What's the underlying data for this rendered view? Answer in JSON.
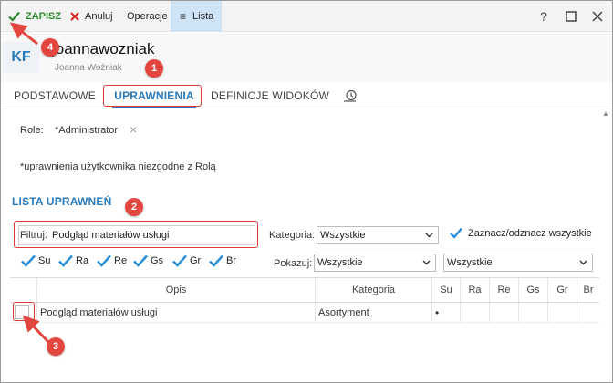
{
  "toolbar": {
    "save_label": "ZAPISZ",
    "cancel_label": "Anuluj",
    "operations_label": "Operacje",
    "list_label": "Lista",
    "help_symbol": "?"
  },
  "user": {
    "avatar_initials": "KF",
    "login": "joannawozniak",
    "full_name": "Joanna Woźniak"
  },
  "tabs": [
    {
      "label": "PODSTAWOWE"
    },
    {
      "label": "UPRAWNIENIA"
    },
    {
      "label": "DEFINICJE WIDOKÓW"
    }
  ],
  "role": {
    "label": "Role:",
    "value": "*Administrator"
  },
  "note": "*uprawnienia użytkownika niezgodne z Rolą",
  "section_title": "LISTA UPRAWNEŃ",
  "filter": {
    "label": "Filtruj:",
    "value": "Podgląd materiałów usługi"
  },
  "category": {
    "label": "Kategoria:",
    "selected": "Wszystkie"
  },
  "check_all_label": "Zaznacz/odznacz wszystkie",
  "show": {
    "label": "Pokazuj:",
    "selected_1": "Wszystkie",
    "selected_2": "Wszystkie"
  },
  "checkboxes": [
    {
      "label": "Su",
      "checked": true
    },
    {
      "label": "Ra",
      "checked": true
    },
    {
      "label": "Re",
      "checked": true
    },
    {
      "label": "Gs",
      "checked": true
    },
    {
      "label": "Gr",
      "checked": true
    },
    {
      "label": "Br",
      "checked": true
    }
  ],
  "table": {
    "columns": [
      "Opis",
      "Kategoria",
      "Su",
      "Ra",
      "Re",
      "Gs",
      "Gr",
      "Br"
    ],
    "rows": [
      {
        "opis": "Podgląd materiałów usługi",
        "kategoria": "Asortyment",
        "su": "•",
        "ra": "",
        "re": "",
        "gs": "",
        "gr": "",
        "br": ""
      }
    ]
  },
  "annotations": [
    "1",
    "2",
    "3",
    "4"
  ],
  "colors": {
    "accent": "#2a79b9",
    "save_green": "#2f8a2f",
    "annotation_red": "#e2463f",
    "list_active_bg": "#cfe3f6"
  }
}
